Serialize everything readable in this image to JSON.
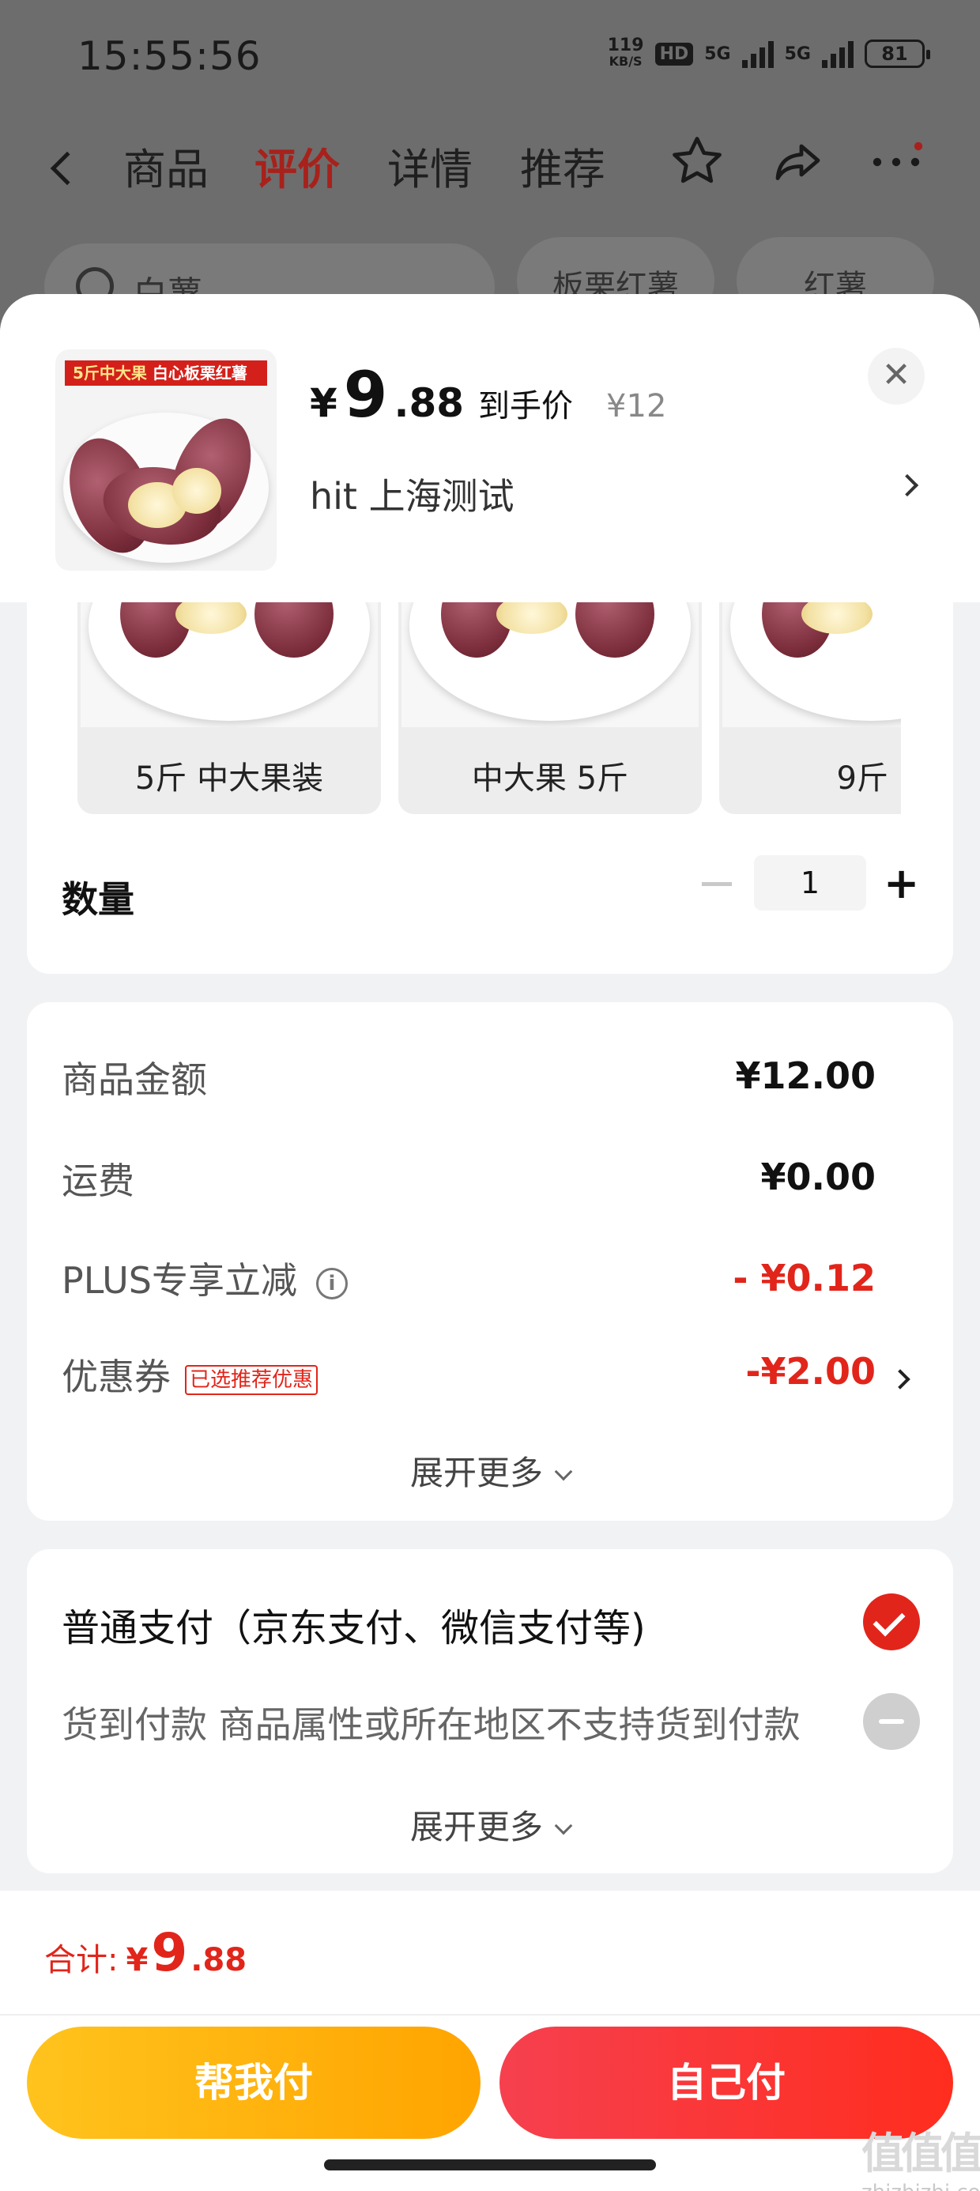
{
  "status_bar": {
    "time": "15:55:56",
    "speed_value": "119",
    "speed_unit": "KB/S",
    "hd": "HD",
    "net1": "5G",
    "net2": "5G",
    "battery": "81"
  },
  "nav": {
    "tabs": [
      "商品",
      "评价",
      "详情",
      "推荐"
    ],
    "active_tab": "评价"
  },
  "bg_search": {
    "text": "白薯",
    "chips": [
      "板栗红薯",
      "红薯"
    ]
  },
  "product": {
    "thumb_banner_a": "5斤中大果",
    "thumb_banner_b": "白心板栗红薯",
    "price_symbol": "¥",
    "price_int": "9",
    "price_dec": ".88",
    "price_label": "到手价",
    "orig_price": "¥12",
    "address": "hit  上海测试"
  },
  "specs": {
    "options": [
      "5斤 中大果装",
      "中大果 5斤",
      "9斤"
    ]
  },
  "quantity": {
    "label": "数量",
    "value": "1"
  },
  "amounts": {
    "rows": [
      {
        "label": "商品金额",
        "value": "¥12.00"
      },
      {
        "label": "运费",
        "value": "¥0.00"
      },
      {
        "label": "PLUS专享立减",
        "value": "- ¥0.12"
      },
      {
        "label": "优惠券",
        "value": "-¥2.00",
        "tag": "已选推荐优惠"
      }
    ],
    "expand": "展开更多"
  },
  "payment": {
    "normal": "普通支付（京东支付、微信支付等)",
    "cod": "货到付款 商品属性或所在地区不支持货到付款",
    "expand": "展开更多"
  },
  "footer": {
    "total_label": "合计:",
    "total_symbol": "¥",
    "total_int": "9",
    "total_dec": ".88",
    "help_pay": "帮我付",
    "self_pay": "自己付",
    "watermark_cn": "值值值",
    "watermark_url": "zhizhizhi.com"
  },
  "colors": {
    "accent": "#e1251b",
    "yellow_btn": "#ffb30f",
    "red_btn": "#f53a30"
  }
}
